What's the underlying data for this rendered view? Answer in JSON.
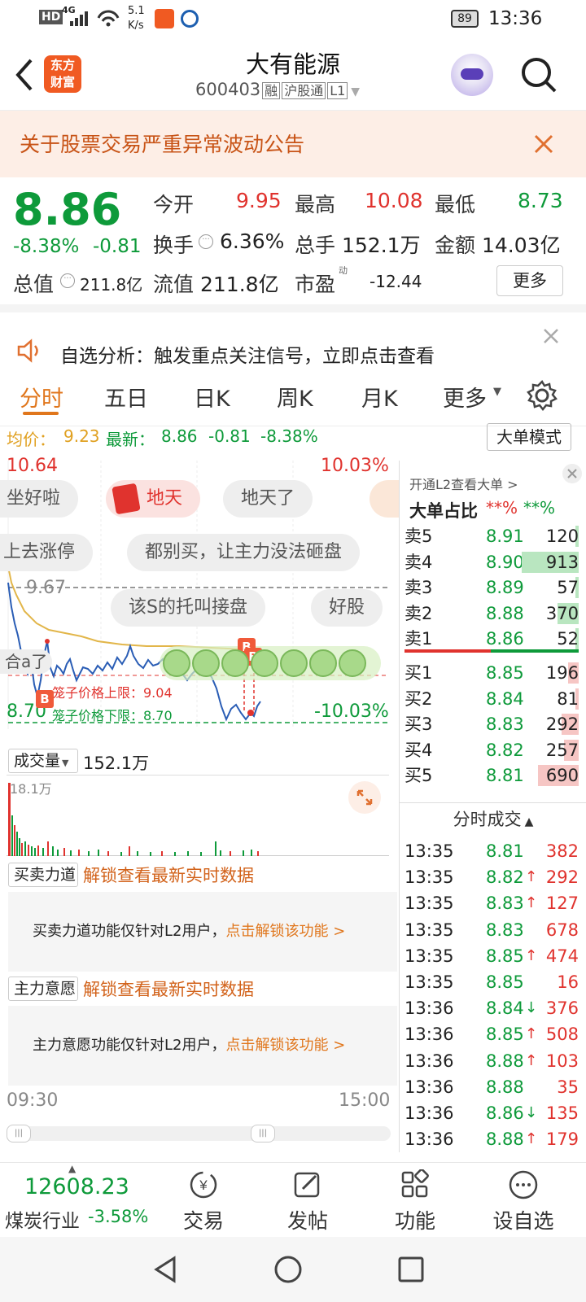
{
  "status": {
    "hd": "HD",
    "net": "4G",
    "speed_top": "5.1",
    "speed_bottom": "K/s",
    "battery": "89",
    "time": "13:36"
  },
  "header": {
    "logo_line1": "东方",
    "logo_line2": "财富",
    "title": "大有能源",
    "code": "600403",
    "badge1": "融",
    "badge2": "沪股通",
    "badge3": "L1"
  },
  "notice": {
    "text": "关于股票交易严重异常波动公告"
  },
  "quote": {
    "price": "8.86",
    "change_pct": "-8.38%",
    "change": "-0.81",
    "open_label": "今开",
    "open": "9.95",
    "high_label": "最高",
    "high": "10.08",
    "low_label": "最低",
    "low": "8.73",
    "turnover_label": "换手",
    "turnover": "6.36%",
    "volume_label": "总手",
    "volume": "152.1万",
    "amount_label": "金额",
    "amount": "14.03亿",
    "mktcap_label": "总值",
    "mktcap": "211.8亿",
    "float_label": "流值",
    "float_cap": "211.8亿",
    "pe_label": "市盈",
    "pe_sup": "动",
    "pe": "-12.44",
    "more": "更多"
  },
  "adv": {
    "text": "自选分析：触发重点关注信号，立即点击查看"
  },
  "tabs": [
    "分时",
    "五日",
    "日K",
    "周K",
    "月K",
    "更多"
  ],
  "avg_line": {
    "avg_label": "均价：",
    "avg": "9.23",
    "latest_label": "最新：",
    "latest": "8.86",
    "chg": "-0.81",
    "pct": "-8.38%",
    "mode_btn": "大单模式"
  },
  "chart": {
    "top_price": "10.64",
    "top_pct": "10.03%",
    "mid_price": "9.67",
    "low_price": "8.70",
    "low_pct": "-10.03%",
    "upper_limit": "笼子价格上限：9.04",
    "lower_limit": "笼子价格下限：8.70",
    "marker_b": "B",
    "comments": [
      "坐好啦",
      "地天",
      "地天了",
      "上去涨停",
      "都别买，让主力没法砸盘",
      "该S的托叫接盘",
      "好股",
      "合a了"
    ]
  },
  "volume_panel": {
    "selector": "成交量",
    "value": "152.1万",
    "max_label": "18.1万"
  },
  "buysell_panel": {
    "selector": "买卖力道",
    "unlock": "解锁查看最新实时数据",
    "desc": "买卖力道功能仅针对L2用户，",
    "link": "点击解锁该功能 >"
  },
  "main_panel": {
    "selector": "主力意愿",
    "unlock": "解锁查看最新实时数据",
    "desc": "主力意愿功能仅针对L2用户，",
    "link": "点击解锁该功能 >"
  },
  "time_axis": {
    "start": "09:30",
    "end": "15:00"
  },
  "orderbook": {
    "l2_link": "开通L2查看大单 >",
    "ratio_label": "大单占比",
    "ratio_red": "**%",
    "ratio_green": "**%",
    "sells": [
      {
        "label": "卖5",
        "price": "8.91",
        "vol": "120",
        "bar": 0.01
      },
      {
        "label": "卖4",
        "price": "8.90",
        "vol": "913",
        "bar": 0.95
      },
      {
        "label": "卖3",
        "price": "8.89",
        "vol": "57",
        "bar": 0.02
      },
      {
        "label": "卖2",
        "price": "8.88",
        "vol": "370",
        "bar": 0.35
      },
      {
        "label": "卖1",
        "price": "8.86",
        "vol": "52",
        "bar": 0.02
      }
    ],
    "buys": [
      {
        "label": "买1",
        "price": "8.85",
        "vol": "196",
        "bar": 0.18
      },
      {
        "label": "买2",
        "price": "8.84",
        "vol": "81",
        "bar": 0.06
      },
      {
        "label": "买3",
        "price": "8.83",
        "vol": "292",
        "bar": 0.28
      },
      {
        "label": "买4",
        "price": "8.82",
        "vol": "257",
        "bar": 0.24
      },
      {
        "label": "买5",
        "price": "8.81",
        "vol": "690",
        "bar": 0.68
      }
    ]
  },
  "trades": {
    "title": "分时成交",
    "rows": [
      {
        "t": "13:35",
        "p": "8.81",
        "arrow": "",
        "v": "382"
      },
      {
        "t": "13:35",
        "p": "8.82",
        "arrow": "↑",
        "v": "292"
      },
      {
        "t": "13:35",
        "p": "8.83",
        "arrow": "↑",
        "v": "127"
      },
      {
        "t": "13:35",
        "p": "8.83",
        "arrow": "",
        "v": "678"
      },
      {
        "t": "13:35",
        "p": "8.85",
        "arrow": "↑",
        "v": "474"
      },
      {
        "t": "13:35",
        "p": "8.85",
        "arrow": "",
        "v": "16"
      },
      {
        "t": "13:36",
        "p": "8.84",
        "arrow": "↓",
        "v": "376"
      },
      {
        "t": "13:36",
        "p": "8.85",
        "arrow": "↑",
        "v": "508"
      },
      {
        "t": "13:36",
        "p": "8.88",
        "arrow": "↑",
        "v": "103"
      },
      {
        "t": "13:36",
        "p": "8.88",
        "arrow": "",
        "v": "35"
      },
      {
        "t": "13:36",
        "p": "8.86",
        "arrow": "↓",
        "v": "135"
      },
      {
        "t": "13:36",
        "p": "8.88",
        "arrow": "↑",
        "v": "179"
      }
    ]
  },
  "bottom": {
    "index_value": "12608.23",
    "index_name": "煤炭行业",
    "index_pct": "-3.58%",
    "trade": "交易",
    "post": "发帖",
    "function": "功能",
    "add": "设自选"
  }
}
